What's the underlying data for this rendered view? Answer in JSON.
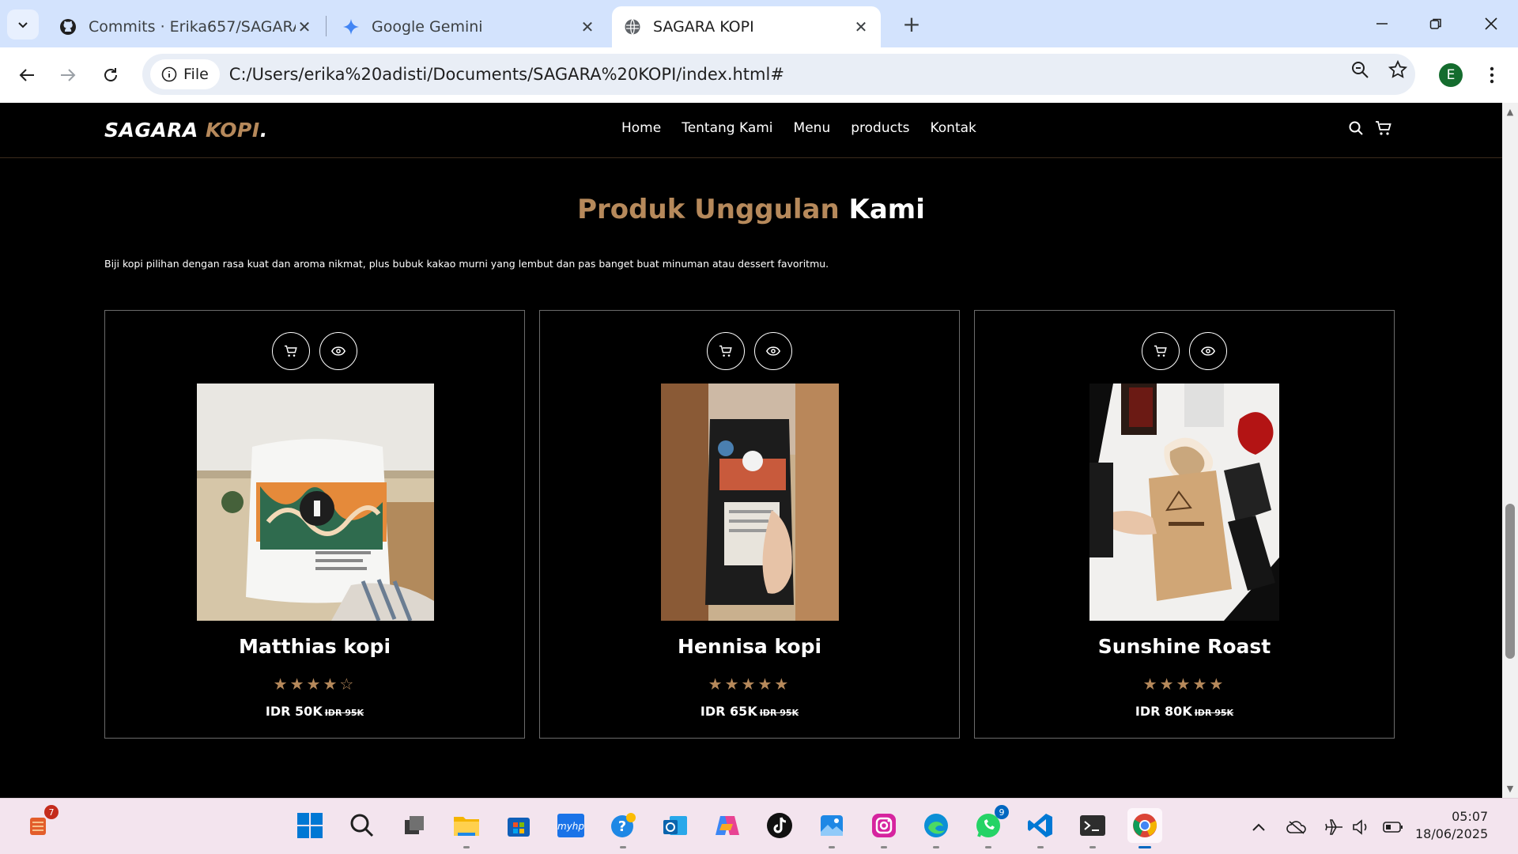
{
  "browser": {
    "tabs": [
      {
        "title": "Commits · Erika657/SAGARA-KO",
        "icon": "github-icon"
      },
      {
        "title": "Google Gemini",
        "icon": "gemini-icon"
      },
      {
        "title": "SAGARA KOPI",
        "icon": "globe-icon",
        "active": true
      }
    ],
    "address_chip": "File",
    "url": "C:/Users/erika%20adisti/Documents/SAGARA%20KOPI/index.html#",
    "profile_initial": "E"
  },
  "site": {
    "logo_main": "SAGARA ",
    "logo_accent": "KOPI",
    "logo_dot": ".",
    "nav": [
      "Home",
      "Tentang Kami",
      "Menu",
      "products",
      "Kontak"
    ],
    "section_title_accent": "Produk Unggulan",
    "section_title_rest": "Kami",
    "section_desc": "Biji kopi pilihan dengan rasa kuat dan aroma nikmat, plus bubuk kakao murni yang lembut dan pas banget buat minuman atau dessert favoritmu.",
    "products": [
      {
        "name": "Matthias kopi",
        "rating": 4,
        "stars": "★★★★☆",
        "price": "IDR 50K",
        "old_price": "IDR 95K"
      },
      {
        "name": "Hennisa kopi",
        "rating": 5,
        "stars": "★★★★★",
        "price": "IDR 65K",
        "old_price": "IDR 95K"
      },
      {
        "name": "Sunshine Roast",
        "rating": 5,
        "stars": "★★★★★",
        "price": "IDR 80K",
        "old_price": "IDR 95K"
      }
    ],
    "accent_color": "#b6895b"
  },
  "taskbar": {
    "badges": {
      "notes": "7",
      "whatsapp": "9"
    },
    "time": "05:07",
    "date": "18/06/2025"
  }
}
